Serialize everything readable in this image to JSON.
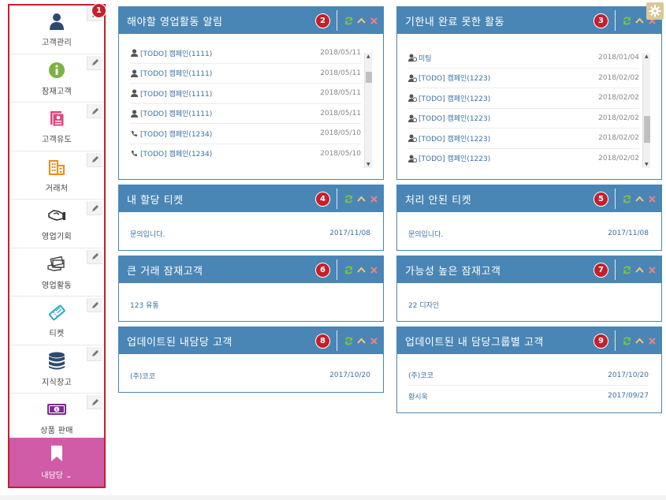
{
  "sidebar": {
    "items": [
      {
        "label": "고객관리",
        "icon": "person-icon"
      },
      {
        "label": "잠재고객",
        "icon": "info-icon"
      },
      {
        "label": "고객유도",
        "icon": "contact-card-icon"
      },
      {
        "label": "거래처",
        "icon": "building-icon"
      },
      {
        "label": "영업기회",
        "icon": "handshake-icon"
      },
      {
        "label": "영업활동",
        "icon": "money-hand-icon"
      },
      {
        "label": "티켓",
        "icon": "ticket-icon"
      },
      {
        "label": "지식창고",
        "icon": "database-icon"
      },
      {
        "label": "상품 판매",
        "icon": "cash-icon"
      }
    ],
    "active": {
      "label": "내담당 ⌄",
      "icon": "bookmark-icon"
    },
    "badge": "1"
  },
  "widgets": {
    "w2": {
      "title": "해야할 영업활동 알림",
      "badge": "2",
      "rows": [
        {
          "text": "[TODO] 캠페인(1111)",
          "date": "2018/05/11"
        },
        {
          "text": "[TODO] 캠페인(1111)",
          "date": "2018/05/11"
        },
        {
          "text": "[TODO] 캠페인(1111)",
          "date": "2018/05/11"
        },
        {
          "text": "[TODO] 캠페인(1111)",
          "date": "2018/05/11"
        },
        {
          "text": "[TODO] 캠페인(1234)",
          "date": "2018/05/10"
        },
        {
          "text": "[TODO] 캠페인(1234)",
          "date": "2018/05/10"
        }
      ]
    },
    "w3": {
      "title": "기한내 완료 못한 활동",
      "badge": "3",
      "rows": [
        {
          "text": "미팅",
          "date": "2018/01/04"
        },
        {
          "text": "[TODO] 캠페인(1223)",
          "date": "2018/02/02"
        },
        {
          "text": "[TODO] 캠페인(1223)",
          "date": "2018/02/02"
        },
        {
          "text": "[TODO] 캠페인(1223)",
          "date": "2018/02/02"
        },
        {
          "text": "[TODO] 캠페인(1223)",
          "date": "2018/02/02"
        },
        {
          "text": "[TODO] 캠페인(1223)",
          "date": "2018/02/02"
        }
      ]
    },
    "w4": {
      "title": "내 할당 티켓",
      "badge": "4",
      "rows": [
        {
          "text": "문의입니다.",
          "date": "2017/11/08"
        }
      ]
    },
    "w5": {
      "title": "처리 안된 티켓",
      "badge": "5",
      "rows": [
        {
          "text": "문의입니다.",
          "date": "2017/11/08"
        }
      ]
    },
    "w6": {
      "title": "큰 거래 잠재고객",
      "badge": "6",
      "rows": [
        {
          "text": "123 유통",
          "date": ""
        }
      ]
    },
    "w7": {
      "title": "가능성 높은 잠재고객",
      "badge": "7",
      "rows": [
        {
          "text": "22 디자인",
          "date": ""
        }
      ]
    },
    "w8": {
      "title": "업데이트된 내담당 고객",
      "badge": "8",
      "rows": [
        {
          "text": "(주)코코",
          "date": "2017/10/20"
        }
      ]
    },
    "w9": {
      "title": "업데이트된 내 담당그룹별 고객",
      "badge": "9",
      "rows": [
        {
          "text": "(주)코코",
          "date": "2017/10/20"
        },
        {
          "text": "황시욱",
          "date": "2017/09/27"
        }
      ]
    }
  },
  "colors": {
    "header": "#4a86b5",
    "badge": "#c4202c",
    "active": "#d05ba6",
    "refresh": "#7cc242",
    "close": "#f08080",
    "collapse": "#f4c47a"
  }
}
